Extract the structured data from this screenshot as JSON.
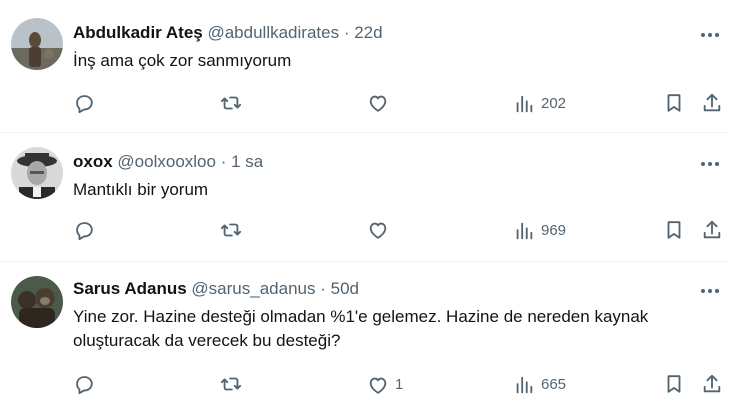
{
  "tweets": [
    {
      "name": "Abdulkadir Ateş",
      "handle": "@abdullkadirates",
      "sep": "·",
      "time": "22d",
      "text": "İnş ama çok zor sanmıyorum",
      "likes": "",
      "views": "202"
    },
    {
      "name": "oxox",
      "handle": "@oolxooxloo",
      "sep": "·",
      "time": "1 sa",
      "text": "Mantıklı bir yorum",
      "likes": "",
      "views": "969"
    },
    {
      "name": "Sarus Adanus",
      "handle": "@sarus_adanus",
      "sep": "·",
      "time": "50d",
      "text": "Yine zor. Hazine desteği olmadan %1'e gelemez. Hazine de nereden kaynak oluşturacak da verecek bu desteği?",
      "likes": "1",
      "views": "665"
    }
  ],
  "icons": {
    "reply": "reply-icon",
    "retweet": "retweet-icon",
    "like": "heart-icon",
    "views": "views-icon",
    "bookmark": "bookmark-icon",
    "share": "share-icon",
    "more": "more-icon"
  },
  "colors": {
    "text": "#0f1419",
    "secondary": "#536471",
    "divider": "#eff3f4"
  }
}
